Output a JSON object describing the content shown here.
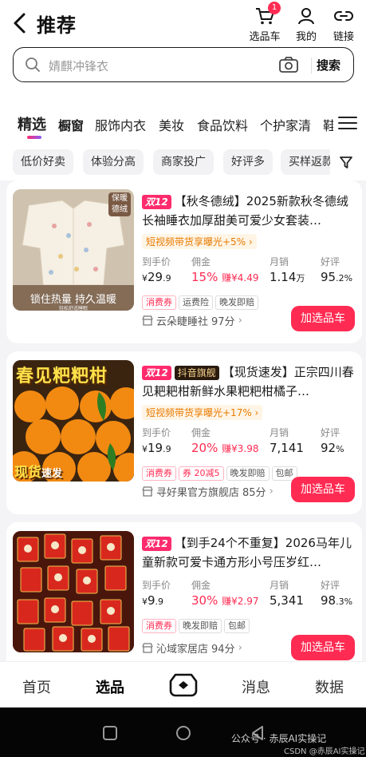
{
  "header": {
    "title": "推荐",
    "actions": [
      {
        "label": "选品车",
        "icon": "cart-icon",
        "badge": "1"
      },
      {
        "label": "我的",
        "icon": "user-icon"
      },
      {
        "label": "链接",
        "icon": "link-icon"
      }
    ]
  },
  "search": {
    "placeholder": "婧麒冲锋衣",
    "button": "搜索"
  },
  "tabs": [
    "精选",
    "橱窗",
    "服饰内衣",
    "美妆",
    "食品饮料",
    "个护家清",
    "鞋"
  ],
  "filters": [
    "低价好卖",
    "体验分高",
    "商家投广",
    "好评多",
    "买样返款"
  ],
  "products": [
    {
      "tag": "双12",
      "flag": "",
      "title": "【秋冬德绒】2025新款秋冬德绒长袖睡衣加厚甜美可爱少女套装…",
      "promo": "短视频带货享曝光+5%",
      "price_label": "到手价",
      "price_sym": "¥",
      "price_int": "29",
      "price_dec": ".9",
      "comm_label": "佣金",
      "comm_rate": "15%",
      "comm_earn": "赚¥4.49",
      "sales_label": "月销",
      "sales_num": "1.14",
      "sales_unit": "万",
      "rating_label": "好评",
      "rating_int": "95",
      "rating_dec": ".2%",
      "chips": [
        "消费券",
        "运费险",
        "晚发即赔"
      ],
      "shop": "云朵睫睡社",
      "shop_score": "97分",
      "add_button": "加选品车",
      "thumb_badge": "保暖德绒",
      "thumb_caption": "锁住热量 持久温暖",
      "thumb_sub": "轻松舒适睡眠"
    },
    {
      "tag": "双12",
      "flag": "抖音旗舰",
      "title": "【现货速发】正宗四川春见耙耙柑新鲜水果粑粑柑橘子…",
      "promo": "短视频带货享曝光+17%",
      "price_label": "到手价",
      "price_sym": "¥",
      "price_int": "19",
      "price_dec": ".9",
      "comm_label": "佣金",
      "comm_rate": "20%",
      "comm_earn": "赚¥3.98",
      "sales_label": "月销",
      "sales_num": "7,141",
      "sales_unit": "",
      "rating_label": "好评",
      "rating_int": "92",
      "rating_dec": "%",
      "chips": [
        "消费券",
        "券 20减5",
        "晚发即赔",
        "包邮"
      ],
      "shop": "寻好果官方旗舰店",
      "shop_score": "85分",
      "add_button": "加选品车",
      "thumb_headline": "春见粑粑柑",
      "thumb_badge": "现货",
      "thumb_sub": "速发"
    },
    {
      "tag": "双12",
      "flag": "",
      "title": "【到手24个不重复】2026马年儿童新款可爱卡通方形小号压岁红…",
      "promo": "",
      "price_label": "到手价",
      "price_sym": "¥",
      "price_int": "9",
      "price_dec": ".9",
      "comm_label": "佣金",
      "comm_rate": "30%",
      "comm_earn": "赚¥2.97",
      "sales_label": "月销",
      "sales_num": "5,341",
      "sales_unit": "",
      "rating_label": "好评",
      "rating_int": "98",
      "rating_dec": ".3%",
      "chips": [
        "消费券",
        "晚发即赔",
        "包邮"
      ],
      "shop": "沁域家居店",
      "shop_score": "94分",
      "add_button": "加选品车"
    }
  ],
  "bottom_nav": [
    "首页",
    "选品",
    "消息",
    "数据"
  ],
  "watermark": "公众号 · 赤辰AI实操记",
  "watermark2": "CSDN @赤辰AI实操记",
  "colors": {
    "accent": "#ff2b52",
    "promo": "#e87a00",
    "tag": "#ff2b6d"
  }
}
